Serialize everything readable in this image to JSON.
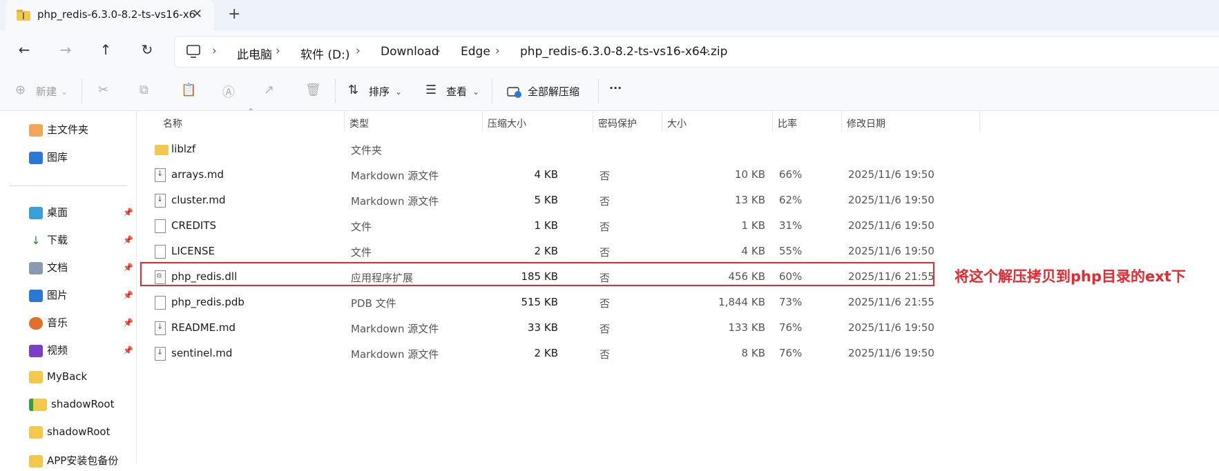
{
  "tab": {
    "title": "php_redis-6.3.0-8.2-ts-vs16-x6",
    "close": "✕",
    "new": "+"
  },
  "nav": {
    "back": "←",
    "forward": "→",
    "up": "↑",
    "refresh": "↻"
  },
  "breadcrumb": [
    "此电脑",
    "软件 (D:)",
    "Download",
    "Edge",
    "php_redis-6.3.0-8.2-ts-vs16-x64.zip"
  ],
  "toolbar": {
    "new_label": "新建",
    "sort_label": "排序",
    "view_label": "查看",
    "extract_label": "全部解压缩",
    "more_label": "···"
  },
  "sidebar": {
    "top_items": [
      "主文件夹",
      "图库"
    ],
    "pinned_items": [
      "桌面",
      "下载",
      "文档",
      "图片",
      "音乐",
      "视频"
    ],
    "folders": [
      "MyBack",
      "shadowRoot",
      "shadowRoot",
      "APP安装包备份"
    ]
  },
  "columns": [
    "名称",
    "类型",
    "压缩大小",
    "密码保护",
    "大小",
    "比率",
    "修改日期"
  ],
  "files": [
    {
      "name": "liblzf",
      "type": "文件夹",
      "packed": "",
      "protected": "",
      "size": "",
      "ratio": "",
      "date": "",
      "icon": "folder"
    },
    {
      "name": "arrays.md",
      "type": "Markdown 源文件",
      "packed": "4 KB",
      "protected": "否",
      "size": "10 KB",
      "ratio": "66%",
      "date": "2025/11/6 19:50",
      "icon": "md"
    },
    {
      "name": "cluster.md",
      "type": "Markdown 源文件",
      "packed": "5 KB",
      "protected": "否",
      "size": "13 KB",
      "ratio": "62%",
      "date": "2025/11/6 19:50",
      "icon": "md"
    },
    {
      "name": "CREDITS",
      "type": "文件",
      "packed": "1 KB",
      "protected": "否",
      "size": "1 KB",
      "ratio": "31%",
      "date": "2025/11/6 19:50",
      "icon": "file"
    },
    {
      "name": "LICENSE",
      "type": "文件",
      "packed": "2 KB",
      "protected": "否",
      "size": "4 KB",
      "ratio": "55%",
      "date": "2025/11/6 19:50",
      "icon": "file"
    },
    {
      "name": "php_redis.dll",
      "type": "应用程序扩展",
      "packed": "185 KB",
      "protected": "否",
      "size": "456 KB",
      "ratio": "60%",
      "date": "2025/11/6 21:55",
      "icon": "dll"
    },
    {
      "name": "php_redis.pdb",
      "type": "PDB 文件",
      "packed": "515 KB",
      "protected": "否",
      "size": "1,844 KB",
      "ratio": "73%",
      "date": "2025/11/6 21:55",
      "icon": "file"
    },
    {
      "name": "README.md",
      "type": "Markdown 源文件",
      "packed": "33 KB",
      "protected": "否",
      "size": "133 KB",
      "ratio": "76%",
      "date": "2025/11/6 19:50",
      "icon": "md"
    },
    {
      "name": "sentinel.md",
      "type": "Markdown 源文件",
      "packed": "2 KB",
      "protected": "否",
      "size": "8 KB",
      "ratio": "76%",
      "date": "2025/11/6 19:50",
      "icon": "md"
    }
  ],
  "annotation": "将这个解压拷贝到php目录的ext下",
  "colors": {
    "annotation": "#e8282f",
    "folder": "#f2c94c"
  }
}
